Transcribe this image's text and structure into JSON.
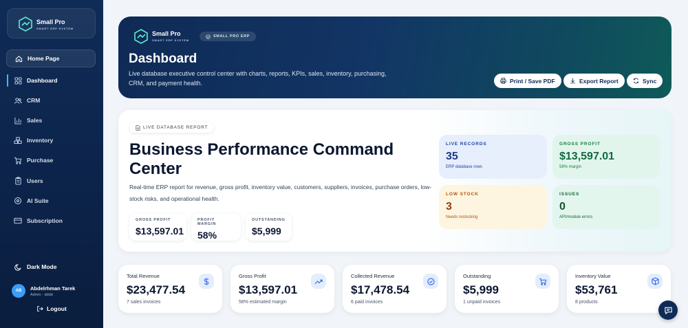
{
  "brand": {
    "name": "Small Pro",
    "tagline": "SMART ERP SYSTEM"
  },
  "sidebar": {
    "home": {
      "label": "Home Page",
      "icon": "home-icon"
    },
    "items": [
      {
        "label": "Dashboard",
        "icon": "grid-icon",
        "active": true
      },
      {
        "label": "CRM",
        "icon": "users-icon"
      },
      {
        "label": "Sales",
        "icon": "bar-chart-icon"
      },
      {
        "label": "Inventory",
        "icon": "boxes-icon"
      },
      {
        "label": "Purchase",
        "icon": "cart-icon"
      },
      {
        "label": "Users",
        "icon": "clipboard-icon"
      },
      {
        "label": "AI Suite",
        "icon": "bot-icon"
      },
      {
        "label": "Subscription",
        "icon": "card-icon"
      }
    ],
    "dark_mode_label": "Dark Mode",
    "user": {
      "initials": "AB",
      "name": "Abdelrhman Tarek",
      "role": "Admin · dddd"
    },
    "logout_label": "Logout"
  },
  "hero": {
    "brand_name": "Small Pro",
    "brand_tagline": "SMART ERP SYSTEM",
    "badge": "SMALL PRO ERP",
    "title": "Dashboard",
    "description": "Live database executive control center with charts, reports, KPIs, sales, inventory, purchasing, CRM, and payment health.",
    "buttons": {
      "print": "Print / Save PDF",
      "export": "Export Report",
      "sync": "Sync"
    }
  },
  "report": {
    "badge": "LIVE DATABASE REPORT",
    "title": "Business Performance Command Center",
    "description": "Real-time ERP report for revenue, gross profit, inventory value, customers, suppliers, invoices, purchase orders, low-stock risks, and operational health.",
    "mini": [
      {
        "label": "GROSS PROFIT",
        "value": "$13,597.01"
      },
      {
        "label": "PROFIT MARGIN",
        "value": "58%"
      },
      {
        "label": "OUTSTANDING",
        "value": "$5,999"
      }
    ],
    "stats": [
      {
        "label": "LIVE RECORDS",
        "value": "35",
        "sub": "ERP database rows"
      },
      {
        "label": "GROSS PROFIT",
        "value": "$13,597.01",
        "sub": "58% margin"
      },
      {
        "label": "LOW STOCK",
        "value": "3",
        "sub": "Needs restocking"
      },
      {
        "label": "ISSUES",
        "value": "0",
        "sub": "API/module errors"
      }
    ]
  },
  "kpis": [
    {
      "label": "Total Revenue",
      "value": "$23,477.54",
      "sub": "7 sales invoices",
      "icon": "dollar-icon"
    },
    {
      "label": "Gross Profit",
      "value": "$13,597.01",
      "sub": "58% estimated margin",
      "icon": "trending-up-icon"
    },
    {
      "label": "Collected Revenue",
      "value": "$17,478.54",
      "sub": "6 paid invoices",
      "icon": "check-circle-icon"
    },
    {
      "label": "Outstanding",
      "value": "$5,999",
      "sub": "1 unpaid invoices",
      "icon": "cart-icon"
    },
    {
      "label": "Inventory Value",
      "value": "$53,761",
      "sub": "8 products",
      "icon": "package-icon"
    }
  ],
  "colors": {
    "sidebar": "#0f2c57",
    "accent": "#38bdf8",
    "hero_start": "#0f2a55",
    "hero_end": "#0f5a58"
  }
}
